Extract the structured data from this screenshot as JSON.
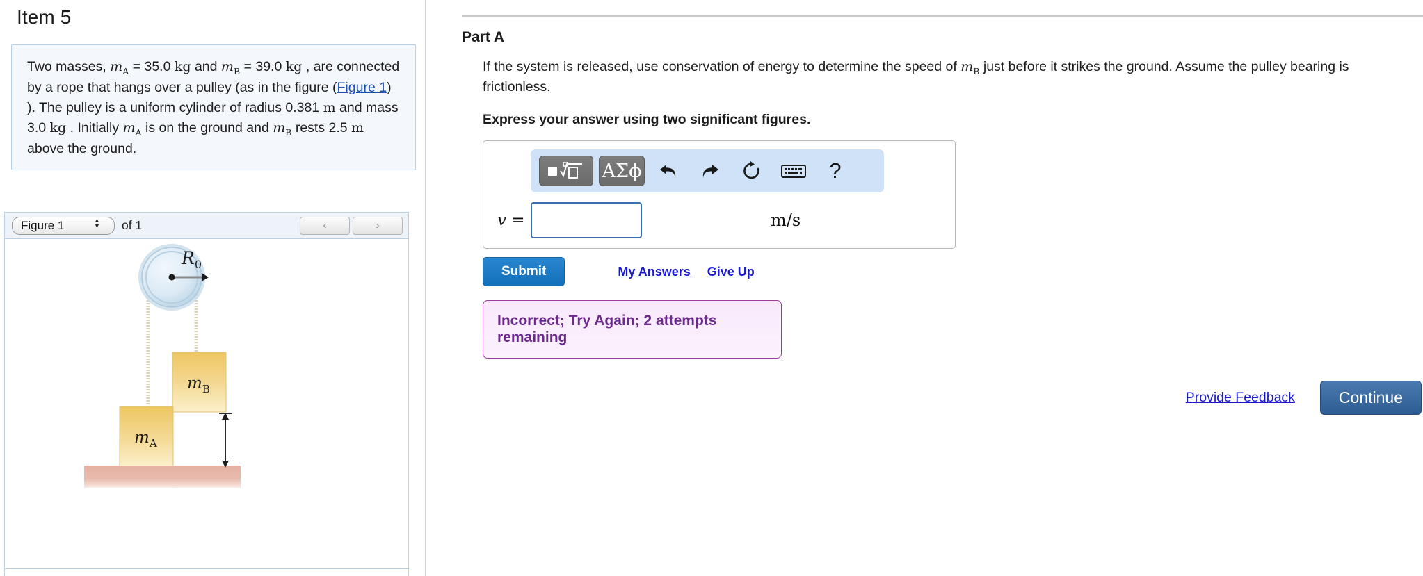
{
  "left": {
    "item_title": "Item 5",
    "problem": {
      "seg1": "Two masses, ",
      "m_a": "m",
      "m_a_sub": "A",
      "eq1": " = 35.0 ",
      "unit_kg1": "kg",
      "seg2": " and ",
      "m_b": "m",
      "m_b_sub": "B",
      "eq2": " = 39.0 ",
      "unit_kg2": "kg",
      "seg3": " , are connected by a rope that hangs over a pulley (as in the figure (",
      "figure_link": "Figure 1",
      "seg4": ") ). The pulley is a uniform cylinder of radius 0.381 ",
      "unit_m1": "m",
      "seg5": " and mass 3.0 ",
      "unit_kg3": "kg",
      "seg6": " . Initially ",
      "m_a2": "m",
      "m_a2_sub": "A",
      "seg7": " is on the ground and ",
      "m_b2": "m",
      "m_b2_sub": "B",
      "seg8": " rests 2.5 ",
      "unit_m2": "m",
      "seg9": " above the ground."
    },
    "figure_selector": {
      "selected": "Figure 1",
      "options": [
        "Figure 1"
      ],
      "of_label": "of 1",
      "prev_icon": "chevron-left-icon",
      "next_icon": "chevron-right-icon",
      "prev_label": "‹",
      "next_label": "›"
    },
    "figure": {
      "pulley_radius_label": "R",
      "pulley_radius_sub": "0",
      "mass_b_label": "m",
      "mass_b_sub": "B",
      "mass_a_label": "m",
      "mass_a_sub": "A",
      "colors": {
        "block_fill_top": "#efc96a",
        "block_fill_bottom": "#fbeec2",
        "ground": "#e6b6a8",
        "pulley_outer": "#cfe0ec",
        "pulley_inner": "#dbe9f4",
        "rope": "#ded6c4"
      }
    }
  },
  "right": {
    "part_title": "Part A",
    "question_seg1": "If the system is released, use conservation of energy to determine the speed of ",
    "question_m": "m",
    "question_m_sub": "B",
    "question_seg2": " just before it strikes the ground. Assume the pulley bearing is frictionless.",
    "express": "Express your answer using two significant figures.",
    "toolbar": {
      "template_icon": "math-template-icon",
      "greek_label": "ΑΣϕ",
      "greek_icon": "greek-symbols-icon",
      "undo_icon": "undo-icon",
      "redo_icon": "redo-icon",
      "reset_icon": "reset-icon",
      "keyboard_icon": "keyboard-icon",
      "help_icon": "help-icon",
      "help_label": "?"
    },
    "answer": {
      "var_label": "v =",
      "value": "",
      "placeholder": "",
      "unit": "m/s"
    },
    "submit_label": "Submit",
    "my_answers_label": "My Answers",
    "give_up_label": "Give Up",
    "feedback_message": "Incorrect; Try Again; 2 attempts remaining",
    "provide_feedback_label": "Provide Feedback",
    "continue_label": "Continue",
    "colors": {
      "submit": "#1270ba",
      "link": "#1a1ad0",
      "feedback_border": "#9b3e9b",
      "feedback_text": "#6b2a8c",
      "continue": "#2d5c92"
    }
  }
}
